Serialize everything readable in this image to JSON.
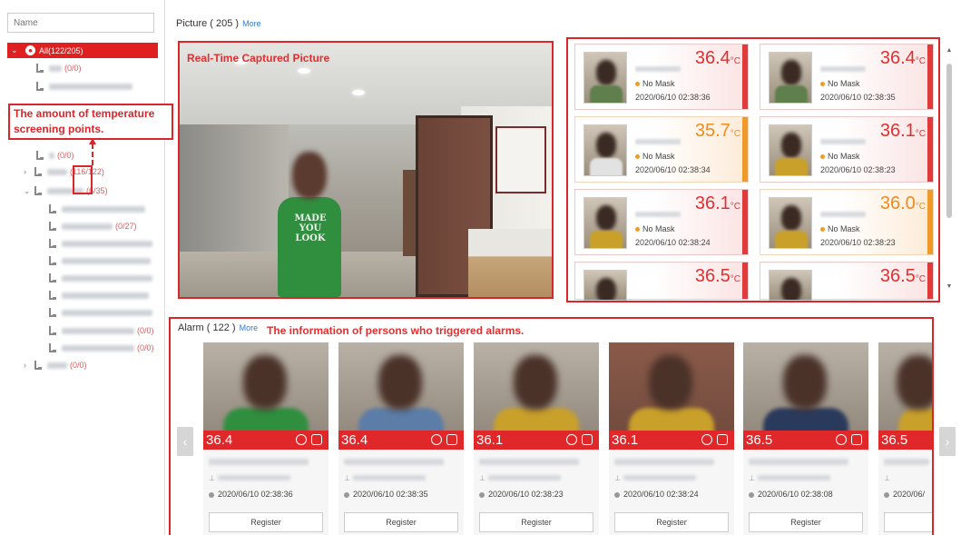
{
  "tree": {
    "search_placeholder": "Name",
    "root_label": "All(122/205)",
    "rows": [
      {
        "count": "(0/0)"
      },
      {
        "count": ""
      },
      {
        "count": "(0/0)"
      },
      {
        "count": "(116/122)"
      },
      {
        "count": "(6/35)"
      },
      {
        "count": ""
      },
      {
        "count": "(0/27)"
      },
      {
        "count": ""
      },
      {
        "count": ""
      },
      {
        "count": ""
      },
      {
        "count": ""
      },
      {
        "count": ""
      },
      {
        "count": "(0/0)"
      },
      {
        "count": "(0/0)"
      },
      {
        "count": "(0/0)"
      }
    ]
  },
  "annotations": {
    "temperature_points": "The amount of temperature screening points.",
    "realtime": "Real-Time Captured Picture",
    "alarm_info": "The information of persons who triggered alarms."
  },
  "picture": {
    "title": "Picture ( 205 )",
    "more": "More",
    "cards": [
      {
        "temp": "36.4",
        "unit": "°C",
        "mask": "No Mask",
        "time": "2020/06/10 02:38:36",
        "level": "high"
      },
      {
        "temp": "36.4",
        "unit": "°C",
        "mask": "No Mask",
        "time": "2020/06/10 02:38:35",
        "level": "high"
      },
      {
        "temp": "35.7",
        "unit": "°C",
        "mask": "No Mask",
        "time": "2020/06/10 02:38:34",
        "level": "warn"
      },
      {
        "temp": "36.1",
        "unit": "°C",
        "mask": "No Mask",
        "time": "2020/06/10 02:38:23",
        "level": "high"
      },
      {
        "temp": "36.1",
        "unit": "°C",
        "mask": "No Mask",
        "time": "2020/06/10 02:38:24",
        "level": "high"
      },
      {
        "temp": "36.0",
        "unit": "°C",
        "mask": "No Mask",
        "time": "2020/06/10 02:38:23",
        "level": "warn"
      },
      {
        "temp": "36.5",
        "unit": "°C",
        "mask": "",
        "time": "",
        "level": "high"
      },
      {
        "temp": "36.5",
        "unit": "°C",
        "mask": "",
        "time": "",
        "level": "high"
      }
    ]
  },
  "video": {
    "shirt_text": "MADE YOU LOOK"
  },
  "alarm": {
    "title": "Alarm ( 122 )",
    "more": "More",
    "register_label": "Register",
    "cards": [
      {
        "temp": "36.4",
        "time": "2020/06/10 02:38:36"
      },
      {
        "temp": "36.4",
        "time": "2020/06/10 02:38:35"
      },
      {
        "temp": "36.1",
        "time": "2020/06/10 02:38:23"
      },
      {
        "temp": "36.1",
        "time": "2020/06/10 02:38:24"
      },
      {
        "temp": "36.5",
        "time": "2020/06/10 02:38:08"
      },
      {
        "temp": "36.5",
        "time": "2020/06/"
      }
    ]
  },
  "colors": {
    "accent_red": "#e02020",
    "warn_orange": "#f08b1c",
    "link_blue": "#2e7bd6"
  },
  "icons": {
    "prev": "chevron-left-icon",
    "next": "chevron-right-icon"
  }
}
